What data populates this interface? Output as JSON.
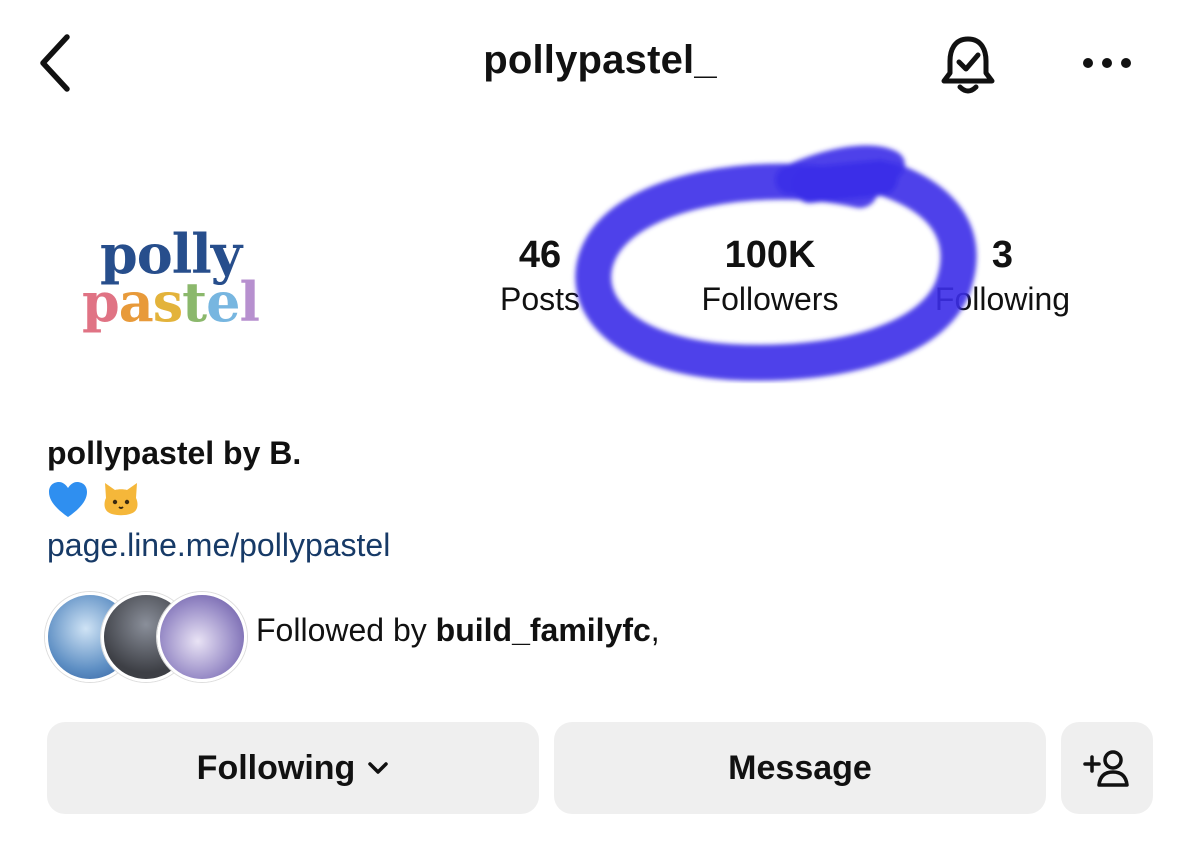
{
  "header": {
    "title": "pollypastel_",
    "icons": [
      "back-chevron-icon",
      "bell-check-icon",
      "more-horizontal-icon"
    ]
  },
  "profile": {
    "logo": {
      "line1": "polly",
      "line2_letters": [
        {
          "ch": "p",
          "color": "#e07384"
        },
        {
          "ch": "a",
          "color": "#e89a3a"
        },
        {
          "ch": "s",
          "color": "#e3b33b"
        },
        {
          "ch": "t",
          "color": "#8bb86c"
        },
        {
          "ch": "e",
          "color": "#77b6e0"
        },
        {
          "ch": "l",
          "color": "#b790cf"
        }
      ]
    },
    "stats": {
      "posts": {
        "value": "46",
        "label": "Posts"
      },
      "followers": {
        "value": "100K",
        "label": "Followers"
      },
      "following": {
        "value": "3",
        "label": "Following"
      }
    },
    "annotation_color": "#3a2fe8"
  },
  "bio": {
    "name": "pollypastel by B.",
    "emojis": [
      "blue-heart-icon",
      "cat-face-icon"
    ],
    "link": "page.line.me/pollypastel"
  },
  "followed_by": {
    "prefix": "Followed by ",
    "user": "build_familyfc",
    "suffix": ","
  },
  "actions": {
    "following_label": "Following",
    "message_label": "Message",
    "add_person_icon": "add-person-icon"
  }
}
